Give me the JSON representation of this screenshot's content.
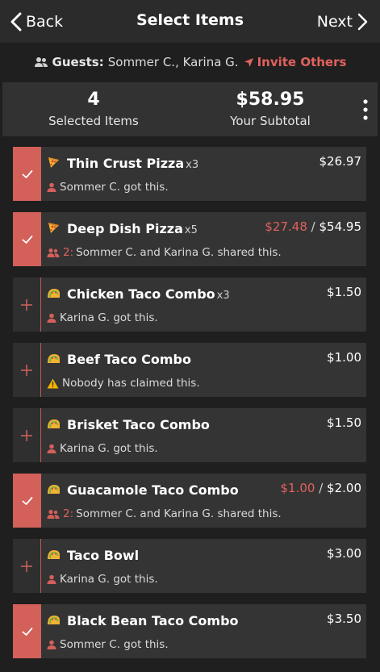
{
  "nav": {
    "back_label": "Back",
    "title": "Select Items",
    "next_label": "Next"
  },
  "guests": {
    "label": "Guests:",
    "names": "Sommer C., Karina G.",
    "invite_label": "Invite Others"
  },
  "summary": {
    "selected_count": "4",
    "selected_label": "Selected Items",
    "subtotal": "$58.95",
    "subtotal_label": "Your Subtotal"
  },
  "items": [
    {
      "name": "Thin Crust Pizza",
      "qty": "x3",
      "icon": "pizza-icon",
      "selected": true,
      "price": "$26.97",
      "share_price": "",
      "claim_type": "single",
      "claim_count": "",
      "claim_text": "Sommer C. got this."
    },
    {
      "name": "Deep Dish Pizza",
      "qty": "x5",
      "icon": "pizza-icon",
      "selected": true,
      "price": "$54.95",
      "share_price": "$27.48",
      "claim_type": "shared",
      "claim_count": "2:",
      "claim_text": "Sommer C. and Karina G. shared this."
    },
    {
      "name": "Chicken Taco Combo",
      "qty": "x3",
      "icon": "taco-icon",
      "selected": false,
      "price": "$1.50",
      "share_price": "",
      "claim_type": "single",
      "claim_count": "",
      "claim_text": "Karina G. got this."
    },
    {
      "name": "Beef Taco Combo",
      "qty": "",
      "icon": "taco-icon",
      "selected": false,
      "price": "$1.00",
      "share_price": "",
      "claim_type": "warning",
      "claim_count": "",
      "claim_text": "Nobody has claimed this."
    },
    {
      "name": "Brisket Taco Combo",
      "qty": "",
      "icon": "taco-icon",
      "selected": false,
      "price": "$1.50",
      "share_price": "",
      "claim_type": "single",
      "claim_count": "",
      "claim_text": "Karina G. got this."
    },
    {
      "name": "Guacamole Taco Combo",
      "qty": "",
      "icon": "taco-icon",
      "selected": true,
      "price": "$2.00",
      "share_price": "$1.00",
      "claim_type": "shared",
      "claim_count": "2:",
      "claim_text": "Sommer C. and Karina G. shared this."
    },
    {
      "name": "Taco Bowl",
      "qty": "",
      "icon": "taco-icon",
      "selected": false,
      "price": "$3.00",
      "share_price": "",
      "claim_type": "single",
      "claim_count": "",
      "claim_text": "Karina G. got this."
    },
    {
      "name": "Black Bean Taco Combo",
      "qty": "",
      "icon": "taco-icon",
      "selected": true,
      "price": "$3.50",
      "share_price": "",
      "claim_type": "single",
      "claim_count": "",
      "claim_text": "Sommer C. got this."
    }
  ],
  "colors": {
    "accent": "#d4605a",
    "accent_text": "#e0625d",
    "background": "#1f1f1f",
    "card": "#343434",
    "warning": "#f5b400"
  }
}
